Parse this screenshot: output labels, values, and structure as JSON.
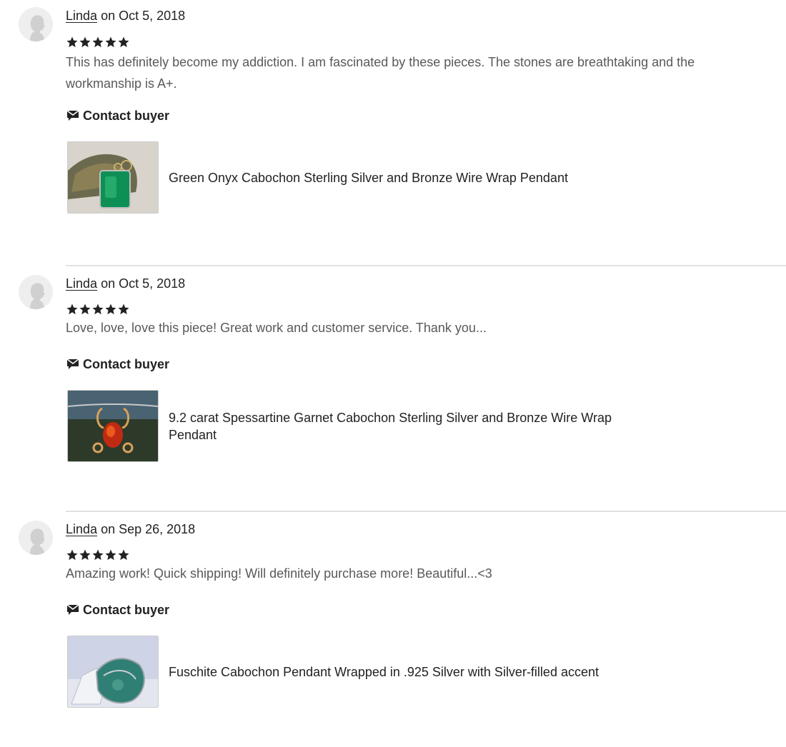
{
  "reviews": [
    {
      "reviewer": "Linda",
      "date_text": "on Oct 5, 2018",
      "rating": 5,
      "text": "This has definitely become my addiction. I am fascinated by these pieces. The stones are breathtaking and the workmanship is A+.",
      "contact_label": "Contact buyer",
      "listing_title": "Green Onyx Cabochon Sterling Silver and Bronze Wire Wrap Pendant"
    },
    {
      "reviewer": "Linda",
      "date_text": "on Oct 5, 2018",
      "rating": 5,
      "text": "Love, love, love this piece! Great work and customer service. Thank you...",
      "contact_label": "Contact buyer",
      "listing_title": "9.2 carat Spessartine Garnet Cabochon Sterling Silver and Bronze Wire Wrap Pendant"
    },
    {
      "reviewer": "Linda",
      "date_text": "on Sep 26, 2018",
      "rating": 5,
      "text": "Amazing work! Quick shipping! Will definitely purchase more! Beautiful...<3",
      "contact_label": "Contact buyer",
      "listing_title": "Fuschite Cabochon Pendant Wrapped in .925 Silver with Silver-filled accent"
    }
  ],
  "colors": {
    "text_primary": "#222222",
    "text_secondary": "#595959",
    "divider": "#e1e1e1",
    "avatar_bg": "#eeeeee"
  },
  "icons": {
    "avatar": "person-silhouette-icon",
    "star": "star-icon",
    "contact": "message-flag-icon"
  }
}
